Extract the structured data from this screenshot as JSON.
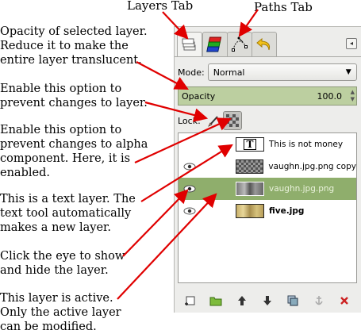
{
  "callouts": {
    "layers_tab": "Layers Tab",
    "paths_tab": "Paths Tab",
    "opacity": "Opacity of selected layer.\nReduce it to make the\nentire layer translucent.",
    "lock_pixels": "Enable this option to\nprevent changes to layer.",
    "lock_alpha": "Enable this option to\nprevent changes to alpha\ncomponent.  Here, it is\nenabled.",
    "text_layer": "This is a text layer.  The\ntext tool automatically\nmakes a new layer.",
    "eye": "Click the eye to show\nand hide the layer.",
    "active_layer": "This layer is active.\nOnly the active layer\ncan be modified."
  },
  "dock": {
    "tabs": [
      {
        "icon": "layers-icon",
        "active": true
      },
      {
        "icon": "channels-icon",
        "active": false
      },
      {
        "icon": "paths-icon",
        "active": false
      },
      {
        "icon": "undo-history-icon",
        "active": false
      }
    ],
    "mode_label": "Mode:",
    "mode_value": "Normal",
    "opacity_label": "Opacity",
    "opacity_value": "100.0",
    "lock_label": "Lock:",
    "lock_alpha_enabled": true,
    "layers": [
      {
        "name": "This is not money",
        "visible": false,
        "type": "text",
        "active": false
      },
      {
        "name": "vaughn.jpg.png copy",
        "visible": true,
        "type": "image",
        "active": false
      },
      {
        "name": "vaughn.jpg.png",
        "visible": true,
        "type": "image",
        "active": true
      },
      {
        "name": "five.jpg",
        "visible": true,
        "type": "image",
        "active": false,
        "bold": true
      }
    ],
    "bottom_buttons": [
      "new-layer-icon",
      "new-layer-group-icon",
      "raise-layer-icon",
      "lower-layer-icon",
      "duplicate-layer-icon",
      "anchor-layer-icon",
      "delete-layer-icon"
    ]
  },
  "colors": {
    "active_row": "#8fae6c",
    "opacity_bg": "#bccfa0",
    "arrow": "#e00000",
    "delete": "#cc2222"
  }
}
